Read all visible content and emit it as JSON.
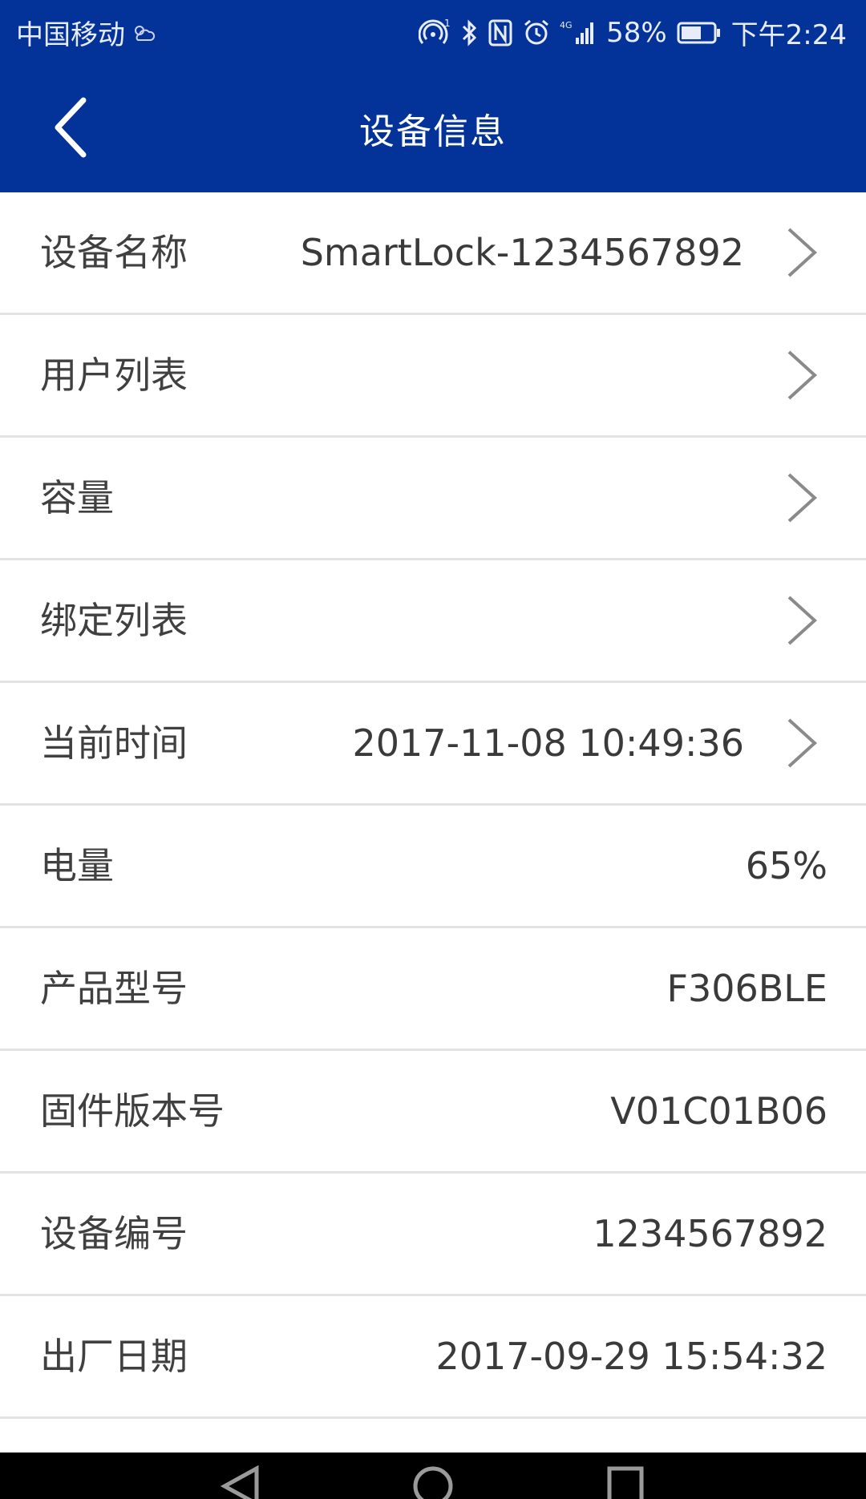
{
  "status_bar": {
    "carrier": "中国移动",
    "battery": "58%",
    "time": "下午2:24",
    "network": "4G"
  },
  "header": {
    "title": "设备信息",
    "background": "#033399"
  },
  "rows": [
    {
      "label": "设备名称",
      "value": "SmartLock-1234567892",
      "arrow": true
    },
    {
      "label": "用户列表",
      "value": "",
      "arrow": true
    },
    {
      "label": "容量",
      "value": "",
      "arrow": true
    },
    {
      "label": "绑定列表",
      "value": "",
      "arrow": true
    },
    {
      "label": "当前时间",
      "value": "2017-11-08 10:49:36",
      "arrow": true
    },
    {
      "label": "电量",
      "value": "65%",
      "arrow": false
    },
    {
      "label": "产品型号",
      "value": "F306BLE",
      "arrow": false
    },
    {
      "label": "固件版本号",
      "value": "V01C01B06",
      "arrow": false
    },
    {
      "label": "设备编号",
      "value": "1234567892",
      "arrow": false
    },
    {
      "label": "出厂日期",
      "value": "2017-09-29 15:54:32",
      "arrow": false
    }
  ],
  "icons": {
    "back": "chevron-left-icon",
    "row_arrow": "chevron-right-icon",
    "nav_back": "triangle-back-icon",
    "nav_home": "circle-home-icon",
    "nav_recent": "square-recent-icon"
  }
}
